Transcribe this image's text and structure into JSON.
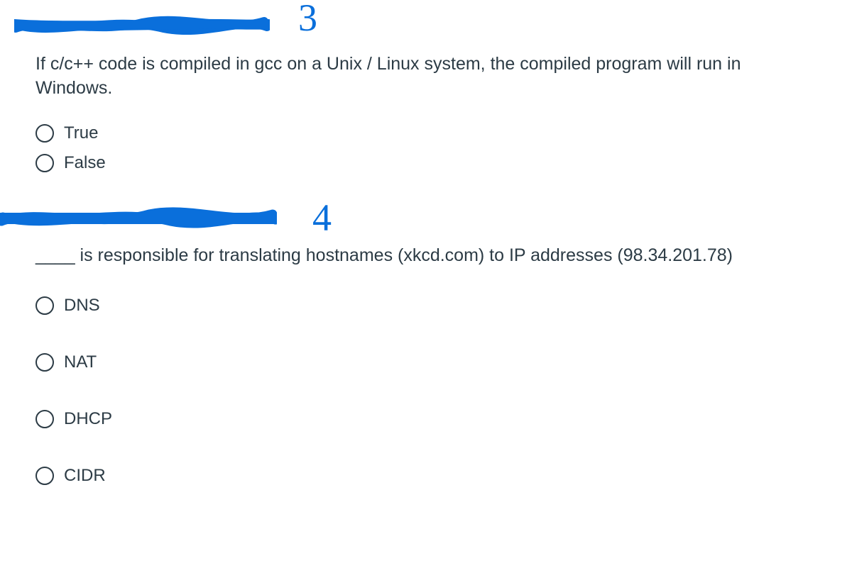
{
  "questions": [
    {
      "handwritten_number": "3",
      "prompt": "If c/c++ code is compiled in gcc on a Unix / Linux system, the compiled program will run in Windows.",
      "options": [
        "True",
        "False"
      ]
    },
    {
      "handwritten_number": "4",
      "prompt": "____ is responsible for translating hostnames (xkcd.com) to IP addresses (98.34.201.78)",
      "options": [
        "DNS",
        "NAT",
        "DHCP",
        "CIDR"
      ]
    }
  ],
  "colors": {
    "ink": "#0a6fdb",
    "text": "#2c3b45"
  }
}
